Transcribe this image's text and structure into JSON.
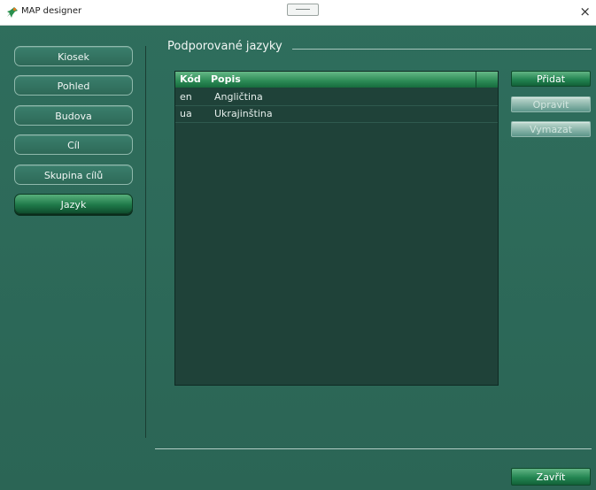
{
  "window": {
    "title": "MAP designer",
    "close_glyph": "×",
    "icon": "pin-icon"
  },
  "nav": {
    "items": [
      {
        "label": "Kiosek"
      },
      {
        "label": "Pohled"
      },
      {
        "label": "Budova"
      },
      {
        "label": "Cíl"
      },
      {
        "label": "Skupina cílů"
      },
      {
        "label": "Jazyk",
        "active": true
      }
    ]
  },
  "section": {
    "title": "Podporované jazyky"
  },
  "table": {
    "columns": [
      "Kód",
      "Popis"
    ],
    "rows": [
      [
        "en",
        "Angličtina"
      ],
      [
        "ua",
        "Ukrajinština"
      ]
    ]
  },
  "actions": {
    "add": "Přidat",
    "edit": "Opravit",
    "delete": "Vymazat"
  },
  "footer": {
    "close": "Zavřít"
  },
  "colors": {
    "background": "#2f6d5c",
    "accent_green": "#238552",
    "table_bg": "#1f4239"
  }
}
